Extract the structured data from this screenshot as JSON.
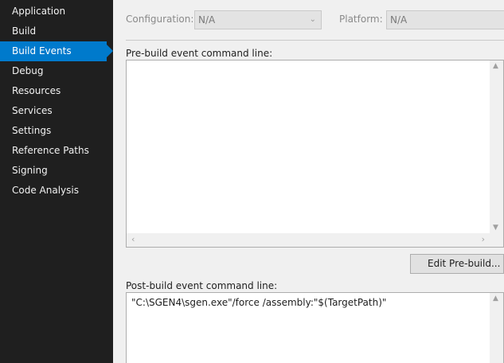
{
  "sidebar": {
    "items": [
      {
        "label": "Application"
      },
      {
        "label": "Build"
      },
      {
        "label": "Build Events"
      },
      {
        "label": "Debug"
      },
      {
        "label": "Resources"
      },
      {
        "label": "Services"
      },
      {
        "label": "Settings"
      },
      {
        "label": "Reference Paths"
      },
      {
        "label": "Signing"
      },
      {
        "label": "Code Analysis"
      }
    ],
    "active_index": 2
  },
  "config_bar": {
    "configuration_label": "Configuration:",
    "configuration_value": "N/A",
    "platform_label": "Platform:",
    "platform_value": "N/A"
  },
  "prebuild": {
    "label": "Pre-build event command line:",
    "value": "",
    "edit_button": "Edit Pre-build..."
  },
  "postbuild": {
    "label": "Post-build event command line:",
    "value": "\"C:\\SGEN4\\sgen.exe\"/force /assembly:\"$(TargetPath)\""
  },
  "colors": {
    "sidebar_bg": "#1f1f1f",
    "accent": "#007acc",
    "panel_bg": "#f0f0f0"
  }
}
